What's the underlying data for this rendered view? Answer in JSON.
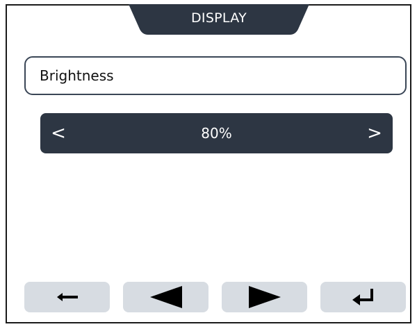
{
  "header": {
    "title": "DISPLAY"
  },
  "setting": {
    "label": "Brightness"
  },
  "selector": {
    "prev_label": "<",
    "value": "80%",
    "next_label": ">"
  },
  "controls": {
    "buttons": [
      {
        "icon": "back-arrow-icon"
      },
      {
        "icon": "left-triangle-icon"
      },
      {
        "icon": "right-triangle-icon"
      },
      {
        "icon": "enter-return-icon"
      }
    ]
  },
  "colors": {
    "dark": "#2d3643",
    "button_bg": "#d7dce2",
    "field_border": "#3a4656"
  }
}
